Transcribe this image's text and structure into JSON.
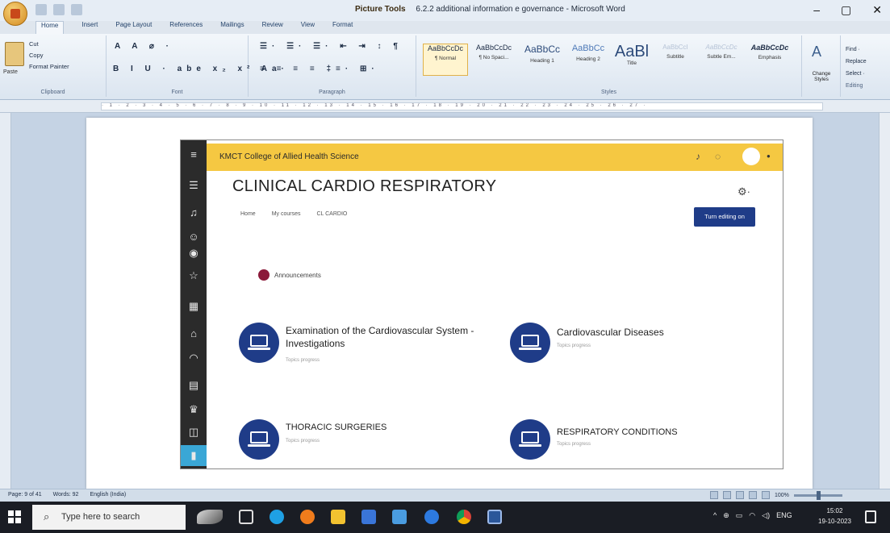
{
  "window": {
    "context_tab": "Picture Tools",
    "title": "6.2.2  additional information e governance - Microsoft Word",
    "controls": [
      "–",
      "▢",
      "✕"
    ]
  },
  "ribbon": {
    "tabs": [
      "Home",
      "Insert",
      "Page Layout",
      "References",
      "Mailings",
      "Review",
      "View",
      "Format"
    ],
    "clipboard": {
      "paste": "Paste",
      "cut": "Cut",
      "copy": "Copy",
      "format_painter": "Format Painter",
      "label": "Clipboard"
    },
    "font_label": "Font",
    "font_row": "B  I  U · abe x₂ x² Aa·",
    "paragraph_label": "Paragraph",
    "paragraph_row": "≡ ≡ ≡ ≡ ‡≡· ⊞·",
    "styles_label": "Styles",
    "styles": [
      {
        "sample": "AaBbCcDc",
        "name": "¶ Normal"
      },
      {
        "sample": "AaBbCcDc",
        "name": "¶ No Spaci..."
      },
      {
        "sample": "AaBbCc",
        "name": "Heading 1"
      },
      {
        "sample": "AaBbCc",
        "name": "Heading 2"
      },
      {
        "sample": "AaBl",
        "name": "Title"
      },
      {
        "sample": "AaBbCcI",
        "name": "Subtitle"
      },
      {
        "sample": "AaBbCcDc",
        "name": "Subtle Em..."
      },
      {
        "sample": "AaBbCcDc",
        "name": "Emphasis"
      }
    ],
    "change_styles": "Change Styles",
    "editing": {
      "find": "Find ·",
      "replace": "Replace",
      "select": "Select ·",
      "label": "Editing"
    }
  },
  "moodle": {
    "site_name": "KMCT College of Allied Health Science",
    "course_title": "CLINICAL CARDIO RESPIRATORY",
    "breadcrumbs": [
      "Home",
      "My courses",
      "CL CARDIO"
    ],
    "edit_button": "Turn editing on",
    "announcements": "Announcements",
    "courses": [
      {
        "title": "Examination of the Cardiovascular System - Investigations",
        "progress": "Topics progress"
      },
      {
        "title": "Cardiovascular Diseases",
        "progress": "Topics progress"
      },
      {
        "title": "THORACIC SURGERIES",
        "progress": "Topics progress"
      },
      {
        "title": "RESPIRATORY CONDITIONS",
        "progress": "Topics progress"
      }
    ]
  },
  "status": {
    "page": "Page: 9 of 41",
    "words": "Words: 92",
    "language": "English (India)",
    "zoom": "100%"
  },
  "taskbar": {
    "search_placeholder": "Type here to search",
    "lang": "ENG",
    "time": "15:02",
    "date": "19-10-2023"
  }
}
